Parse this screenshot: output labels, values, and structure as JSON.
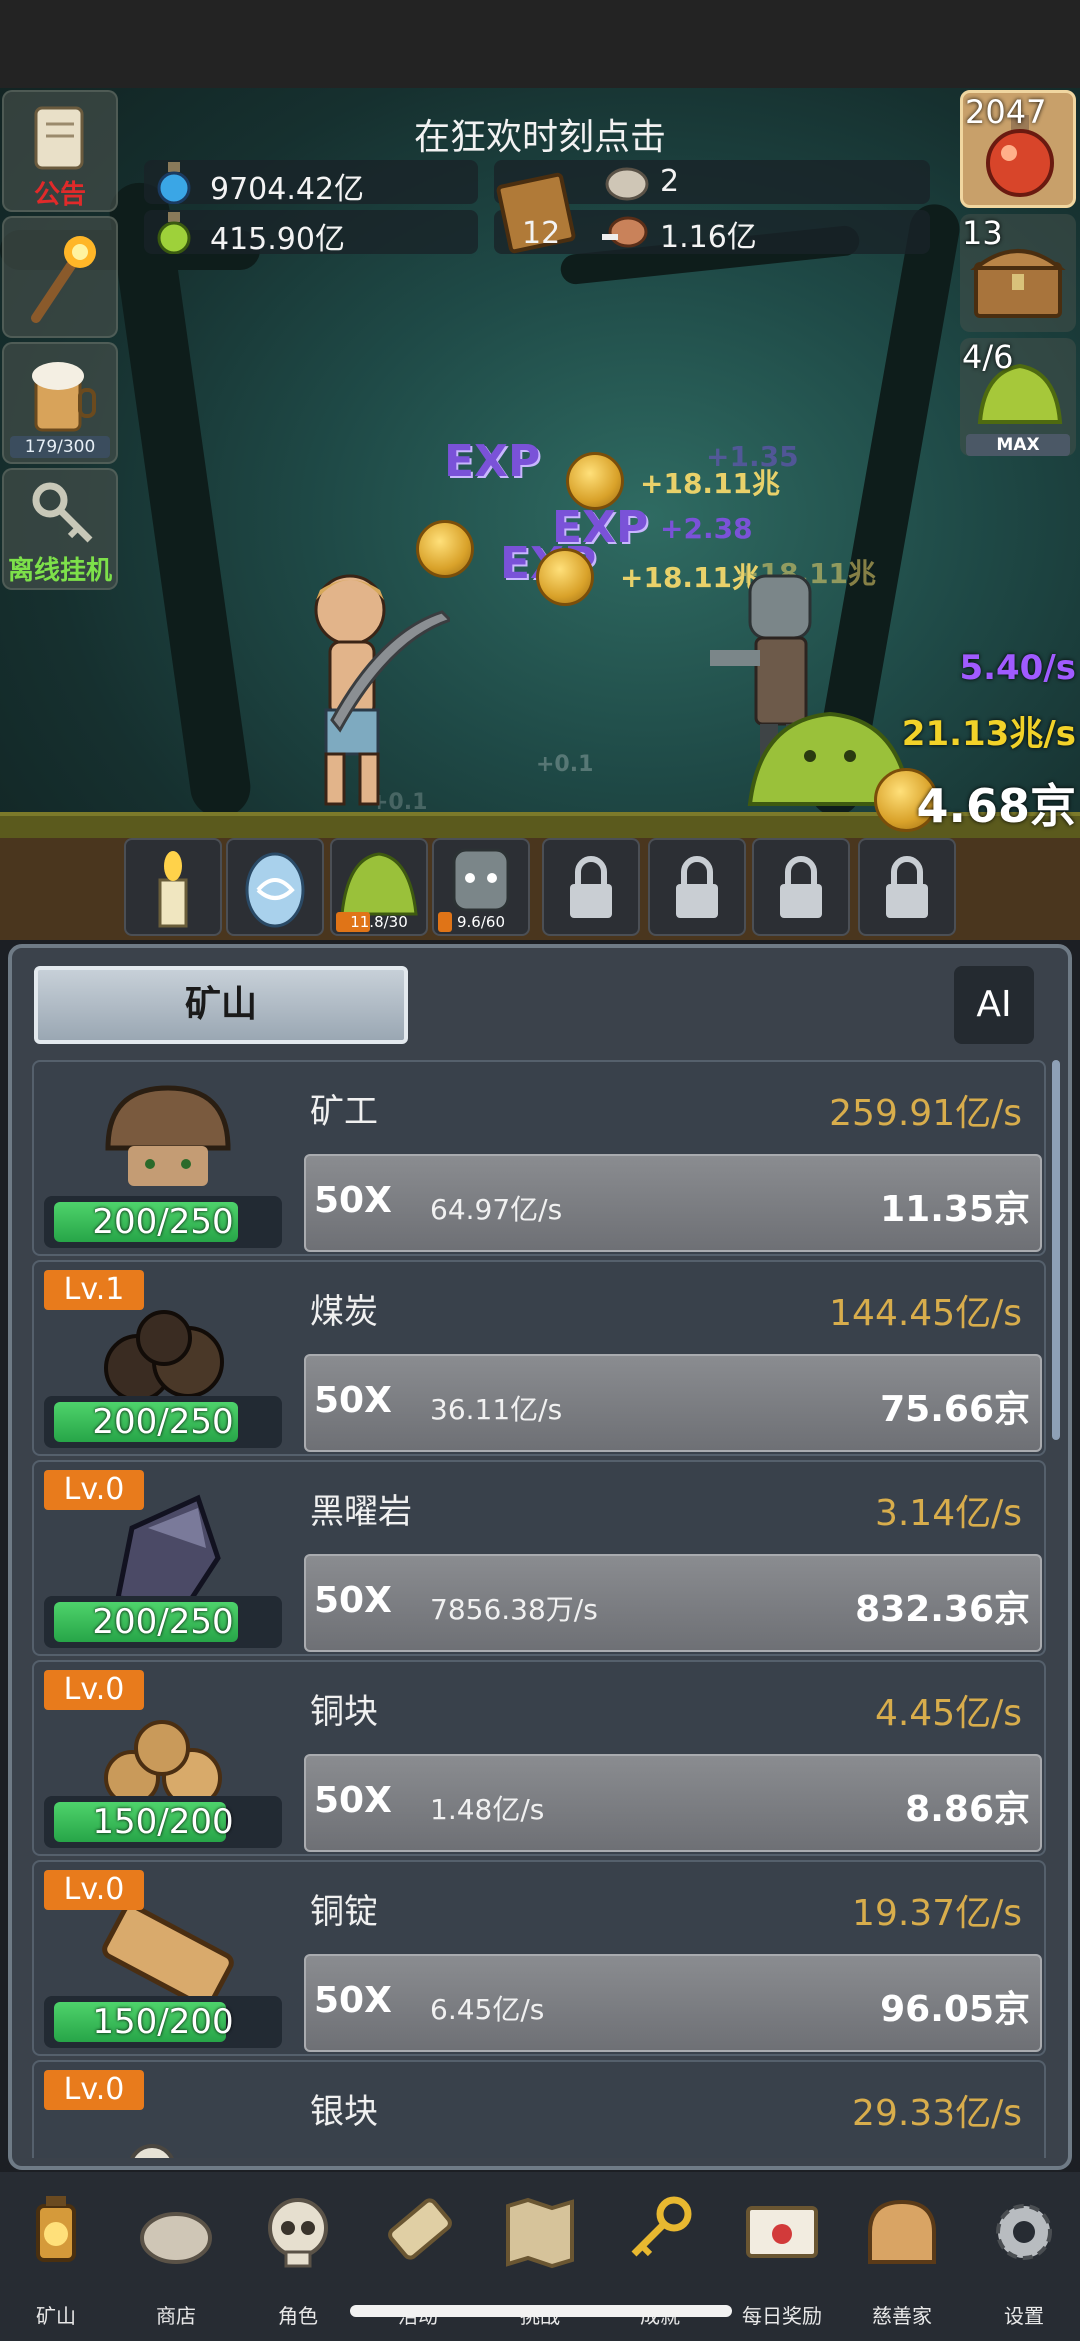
{
  "hud": {
    "left_buttons": [
      {
        "label": "公告",
        "label_color": "#e12a2a"
      },
      {
        "label": ""
      },
      {
        "counter": "179/300"
      },
      {
        "label": "离线挂机",
        "label_color": "#7de04a"
      }
    ],
    "right_buttons": [
      {
        "count": "2047"
      },
      {
        "count": "13"
      },
      {
        "count": "4/6",
        "badge": "MAX"
      }
    ],
    "title": "在狂欢时刻点击",
    "resources": {
      "blue_potion": "9704.42亿",
      "green_potion": "415.90亿",
      "book": "12",
      "stone": "2",
      "meat": "1.16亿"
    }
  },
  "battle": {
    "floating_texts": [
      "+18.11兆",
      "+2.38",
      "+18.11兆",
      "+18.11兆",
      "+1.35",
      "+0.1",
      "+0.1"
    ],
    "exp_labels": [
      "EXP",
      "EXP",
      "EXP"
    ],
    "rate_purple": "5.40/s",
    "rate_yellow": "21.13兆/s",
    "coins_total": "4.68京"
  },
  "slots": [
    {
      "item": "candle"
    },
    {
      "item": "egg"
    },
    {
      "item": "slime",
      "progress": "11.8/30",
      "fill": 0.39
    },
    {
      "item": "zombie",
      "progress": "9.6/60",
      "fill": 0.16
    },
    {
      "item": "locked"
    },
    {
      "item": "locked"
    },
    {
      "item": "locked"
    },
    {
      "item": "locked"
    }
  ],
  "panel": {
    "tab": "矿山",
    "ai_label": "AI",
    "rows": [
      {
        "level": "",
        "name": "矿工",
        "rate": "259.91亿/s",
        "multiplier": "50X",
        "unit_rate": "64.97亿/s",
        "cost": "11.35京",
        "capacity": "200/250",
        "cap_fill": 0.8,
        "icon": "miner"
      },
      {
        "level": "Lv.1",
        "name": "煤炭",
        "rate": "144.45亿/s",
        "multiplier": "50X",
        "unit_rate": "36.11亿/s",
        "cost": "75.66京",
        "capacity": "200/250",
        "cap_fill": 0.8,
        "icon": "coal"
      },
      {
        "level": "Lv.0",
        "name": "黑曜岩",
        "rate": "3.14亿/s",
        "multiplier": "50X",
        "unit_rate": "7856.38万/s",
        "cost": "832.36京",
        "capacity": "200/250",
        "cap_fill": 0.8,
        "icon": "obsidian"
      },
      {
        "level": "Lv.0",
        "name": "铜块",
        "rate": "4.45亿/s",
        "multiplier": "50X",
        "unit_rate": "1.48亿/s",
        "cost": "8.86京",
        "capacity": "150/200",
        "cap_fill": 0.75,
        "icon": "copper-ore"
      },
      {
        "level": "Lv.0",
        "name": "铜锭",
        "rate": "19.37亿/s",
        "multiplier": "50X",
        "unit_rate": "6.45亿/s",
        "cost": "96.05京",
        "capacity": "150/200",
        "cap_fill": 0.75,
        "icon": "copper-ingot"
      },
      {
        "level": "Lv.0",
        "name": "银块",
        "rate": "29.33亿/s",
        "multiplier": "",
        "unit_rate": "",
        "cost": "",
        "capacity": "",
        "cap_fill": 0,
        "icon": "silver-ore"
      }
    ]
  },
  "nav": [
    {
      "label": "矿山",
      "icon": "lantern-icon"
    },
    {
      "label": "商店",
      "icon": "stone-icon"
    },
    {
      "label": "角色",
      "icon": "skull-icon"
    },
    {
      "label": "活动",
      "icon": "scroll-icon"
    },
    {
      "label": "挑战",
      "icon": "map-icon"
    },
    {
      "label": "成就",
      "icon": "key-icon"
    },
    {
      "label": "每日奖励",
      "icon": "letter-icon"
    },
    {
      "label": "慈善家",
      "icon": "bread-icon"
    },
    {
      "label": "设置",
      "icon": "gear-icon"
    }
  ]
}
